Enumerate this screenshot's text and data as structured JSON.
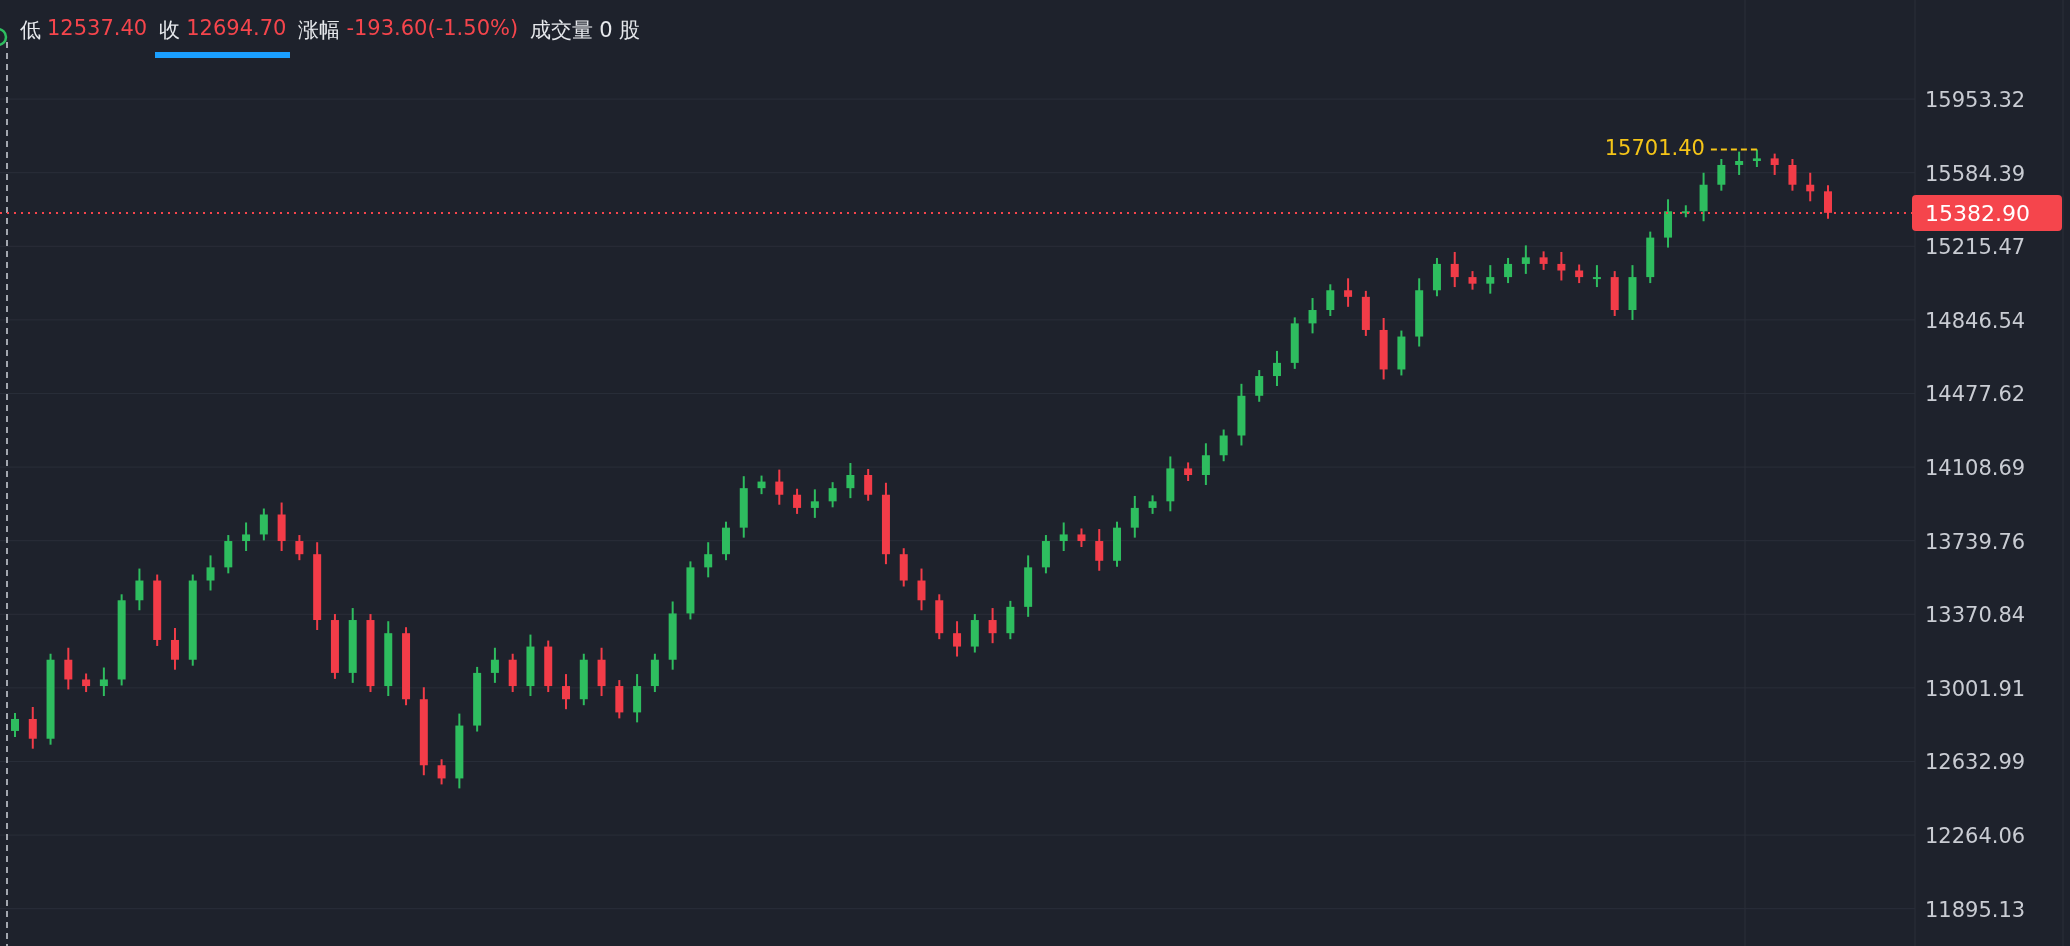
{
  "header": {
    "items": [
      {
        "label": "低",
        "value": "12537.40",
        "color": "#f5454c",
        "selected": false
      },
      {
        "label": "收",
        "value": "12694.70",
        "color": "#f5454c",
        "selected": true
      },
      {
        "label": "涨幅",
        "value": "-193.60(-1.50%)",
        "color": "#f5454c",
        "selected": false
      },
      {
        "label": "成交量",
        "value": "0 股",
        "color": "#e6e8ec",
        "selected": false
      }
    ]
  },
  "chart": {
    "chart_data": {
      "type": "candlestick",
      "grid": true,
      "ohlc": [
        [
          12786,
          12876,
          12756,
          12846
        ],
        [
          12846,
          12906,
          12697,
          12747
        ],
        [
          12747,
          13173,
          12717,
          13143
        ],
        [
          13143,
          13203,
          12994,
          13044
        ],
        [
          13044,
          13074,
          12981,
          13011
        ],
        [
          13011,
          13104,
          12961,
          13044
        ],
        [
          13044,
          13471,
          13014,
          13441
        ],
        [
          13441,
          13600,
          13391,
          13540
        ],
        [
          13540,
          13570,
          13212,
          13242
        ],
        [
          13242,
          13302,
          13093,
          13143
        ],
        [
          13143,
          13570,
          13113,
          13540
        ],
        [
          13540,
          13666,
          13490,
          13606
        ],
        [
          13606,
          13768,
          13576,
          13738
        ],
        [
          13738,
          13831,
          13688,
          13771
        ],
        [
          13771,
          13901,
          13741,
          13871
        ],
        [
          13871,
          13931,
          13688,
          13738
        ],
        [
          13738,
          13768,
          13642,
          13672
        ],
        [
          13672,
          13732,
          13292,
          13342
        ],
        [
          13342,
          13372,
          13047,
          13077
        ],
        [
          13077,
          13402,
          13027,
          13342
        ],
        [
          13342,
          13372,
          12981,
          13011
        ],
        [
          13011,
          13336,
          12961,
          13276
        ],
        [
          13276,
          13306,
          12915,
          12945
        ],
        [
          12945,
          13005,
          12564,
          12614
        ],
        [
          12614,
          12644,
          12518,
          12548
        ],
        [
          12548,
          12873,
          12498,
          12813
        ],
        [
          12813,
          13107,
          12783,
          13077
        ],
        [
          13077,
          13203,
          13027,
          13143
        ],
        [
          13143,
          13173,
          12981,
          13011
        ],
        [
          13011,
          13269,
          12961,
          13209
        ],
        [
          13209,
          13239,
          12981,
          13011
        ],
        [
          13011,
          13071,
          12895,
          12945
        ],
        [
          12945,
          13173,
          12915,
          13143
        ],
        [
          13143,
          13203,
          12961,
          13011
        ],
        [
          13011,
          13041,
          12849,
          12879
        ],
        [
          12879,
          13071,
          12829,
          13011
        ],
        [
          13011,
          13173,
          12981,
          13143
        ],
        [
          13143,
          13435,
          13093,
          13375
        ],
        [
          13375,
          13636,
          13345,
          13606
        ],
        [
          13606,
          13732,
          13556,
          13672
        ],
        [
          13672,
          13835,
          13642,
          13805
        ],
        [
          13805,
          14063,
          13755,
          14003
        ],
        [
          14003,
          14066,
          13973,
          14036
        ],
        [
          14036,
          14096,
          13920,
          13970
        ],
        [
          13970,
          14000,
          13874,
          13904
        ],
        [
          13904,
          13997,
          13854,
          13937
        ],
        [
          13937,
          14033,
          13907,
          14003
        ],
        [
          14003,
          14129,
          13953,
          14069
        ],
        [
          14069,
          14099,
          13940,
          13970
        ],
        [
          13970,
          14030,
          13622,
          13672
        ],
        [
          13672,
          13702,
          13510,
          13540
        ],
        [
          13540,
          13600,
          13391,
          13441
        ],
        [
          13441,
          13471,
          13246,
          13276
        ],
        [
          13276,
          13336,
          13159,
          13209
        ],
        [
          13209,
          13372,
          13179,
          13342
        ],
        [
          13342,
          13402,
          13226,
          13276
        ],
        [
          13276,
          13438,
          13246,
          13408
        ],
        [
          13408,
          13666,
          13358,
          13606
        ],
        [
          13606,
          13768,
          13576,
          13738
        ],
        [
          13738,
          13831,
          13688,
          13771
        ],
        [
          13771,
          13801,
          13708,
          13738
        ],
        [
          13738,
          13798,
          13589,
          13639
        ],
        [
          13639,
          13835,
          13609,
          13805
        ],
        [
          13805,
          13964,
          13755,
          13904
        ],
        [
          13904,
          13967,
          13874,
          13937
        ],
        [
          13937,
          14162,
          13887,
          14102
        ],
        [
          14102,
          14132,
          14039,
          14069
        ],
        [
          14069,
          14228,
          14019,
          14168
        ],
        [
          14168,
          14297,
          14138,
          14267
        ],
        [
          14267,
          14526,
          14217,
          14466
        ],
        [
          14466,
          14595,
          14436,
          14565
        ],
        [
          14565,
          14691,
          14515,
          14631
        ],
        [
          14631,
          14859,
          14601,
          14829
        ],
        [
          14829,
          14956,
          14779,
          14896
        ],
        [
          14896,
          15025,
          14866,
          14995
        ],
        [
          14995,
          15055,
          14912,
          14962
        ],
        [
          14962,
          14992,
          14766,
          14796
        ],
        [
          14796,
          14856,
          14548,
          14598
        ],
        [
          14598,
          14793,
          14568,
          14763
        ],
        [
          14763,
          15055,
          14713,
          14995
        ],
        [
          14995,
          15157,
          14965,
          15127
        ],
        [
          15127,
          15187,
          15011,
          15061
        ],
        [
          15061,
          15091,
          14998,
          15028
        ],
        [
          15028,
          15121,
          14978,
          15061
        ],
        [
          15061,
          15157,
          15031,
          15127
        ],
        [
          15127,
          15220,
          15077,
          15160
        ],
        [
          15160,
          15190,
          15097,
          15127
        ],
        [
          15127,
          15187,
          15044,
          15094
        ],
        [
          15094,
          15124,
          15031,
          15061
        ],
        [
          15061,
          15121,
          15011,
          15061
        ],
        [
          15061,
          15091,
          14866,
          14896
        ],
        [
          14896,
          15121,
          14846,
          15061
        ],
        [
          15061,
          15289,
          15031,
          15259
        ],
        [
          15259,
          15451,
          15209,
          15391
        ],
        [
          15391,
          15421,
          15361,
          15391
        ],
        [
          15391,
          15584,
          15341,
          15524
        ],
        [
          15524,
          15653,
          15494,
          15623
        ],
        [
          15623,
          15690,
          15573,
          15643
        ],
        [
          15643,
          15701,
          15613,
          15656
        ],
        [
          15656,
          15680,
          15573,
          15623
        ],
        [
          15623,
          15653,
          15494,
          15524
        ],
        [
          15524,
          15584,
          15441,
          15491
        ],
        [
          15491,
          15521,
          15353,
          15383
        ]
      ],
      "ylim": [
        11708,
        16450
      ],
      "yticks": [
        {
          "value": 15953.32,
          "label": "15953.32"
        },
        {
          "value": 15584.39,
          "label": "15584.39"
        },
        {
          "value": 15215.47,
          "label": "15215.47"
        },
        {
          "value": 14846.54,
          "label": "14846.54"
        },
        {
          "value": 14477.62,
          "label": "14477.62"
        },
        {
          "value": 14108.69,
          "label": "14108.69"
        },
        {
          "value": 13739.76,
          "label": "13739.76"
        },
        {
          "value": 13370.84,
          "label": "13370.84"
        },
        {
          "value": 13001.91,
          "label": "13001.91"
        },
        {
          "value": 12632.99,
          "label": "12632.99"
        },
        {
          "value": 12264.06,
          "label": "12264.06"
        },
        {
          "value": 11895.13,
          "label": "11895.13"
        }
      ],
      "annotations": [
        "15701.40"
      ],
      "ref_lines": [
        {
          "axis": "y",
          "value": 15382.9,
          "label": "15382.90"
        }
      ]
    }
  }
}
